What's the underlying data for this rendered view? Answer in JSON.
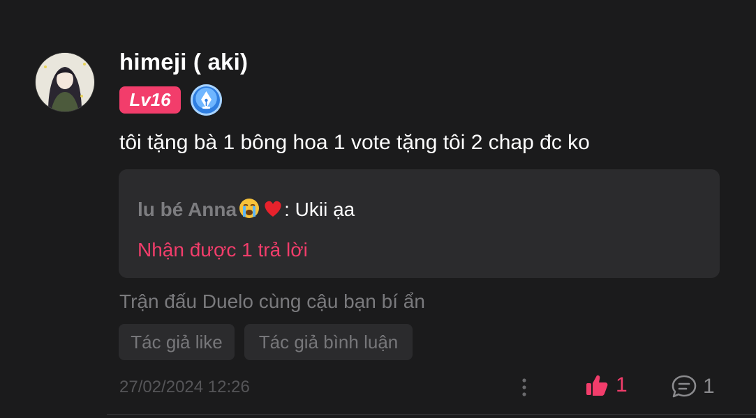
{
  "comment": {
    "username": "himeji ( aki)",
    "level_badge": "Lv16",
    "text": "tôi tặng bà 1 bông hoa 1 vote tặng tôi 2 chap đc ko",
    "reply_preview": {
      "author": "lu bé Anna",
      "author_emojis": [
        "loudly-crying-face",
        "red-heart"
      ],
      "separator": ":",
      "body": " Ukii ạa",
      "reply_count_label": "Nhận được 1 trả lời"
    },
    "event_text": "Trận đấu Duelo cùng cậu bạn bí ẩn",
    "tags": [
      "Tác giả like",
      "Tác giả bình luận"
    ],
    "timestamp": "27/02/2024 12:26",
    "like_count": "1",
    "comment_count": "1"
  },
  "colors": {
    "background": "#1b1b1c",
    "accent": "#f23d6b",
    "card": "#2b2b2d",
    "muted_text": "#7a7a7d"
  }
}
